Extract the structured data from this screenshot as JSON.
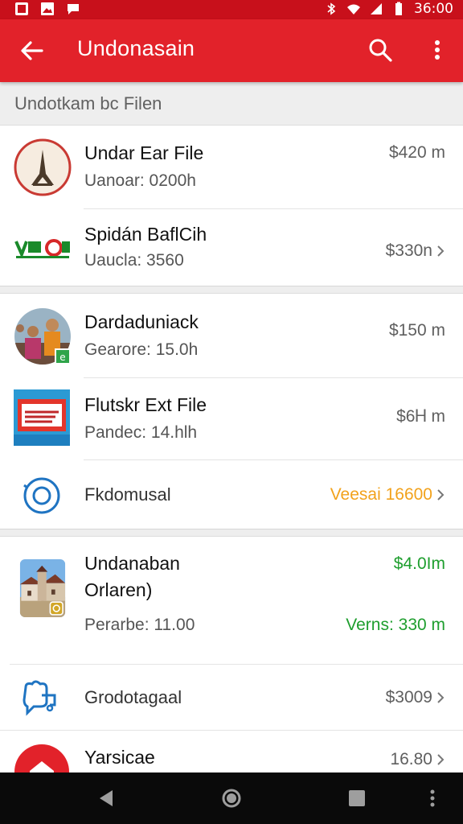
{
  "status_bar": {
    "time": "36:00"
  },
  "app_bar": {
    "title": "Undonasain"
  },
  "section_header": "Undotkam bc Filen",
  "colors": {
    "primary": "#e2222a",
    "status_bar": "#c8101b",
    "accent_orange": "#f2a21c",
    "accent_green": "#1e9e2e"
  },
  "group1": [
    {
      "title": "Undar Ear File",
      "subtitle": "Uanoar: 0200h",
      "value": "$420 m",
      "icon": "eiffel-tower-avatar"
    },
    {
      "title": "Spidán BaflCih",
      "subtitle": "Uaucla: 3560",
      "value": "$330n",
      "icon": "vendor-logo-avatar"
    }
  ],
  "group2": [
    {
      "title": "Dardaduniack",
      "subtitle": "Gearore: 15.0h",
      "value": "$150 m",
      "icon": "people-photo-avatar"
    },
    {
      "title": "Flutskr Ext File",
      "subtitle": "Pandec: 14.hlh",
      "value": "$6Ꮋ m",
      "icon": "screen-sign-avatar"
    },
    {
      "title": "Fkdomusal",
      "value": "Veesai 16600",
      "icon": "camera-lens-icon"
    }
  ],
  "group3": [
    {
      "title": "Undanaban",
      "title_line2": "Orlaren)",
      "subtitle": "Perarbe: 11.00",
      "value": "$4.0Im",
      "value2": "Verns: 330 m",
      "icon": "building-photo-avatar"
    },
    {
      "title": "Grodotagaal",
      "value": "$3009",
      "icon": "puzzle-chat-icon"
    },
    {
      "title": "Yarsicae",
      "value": "16.80",
      "icon": "home-red-icon"
    }
  ]
}
